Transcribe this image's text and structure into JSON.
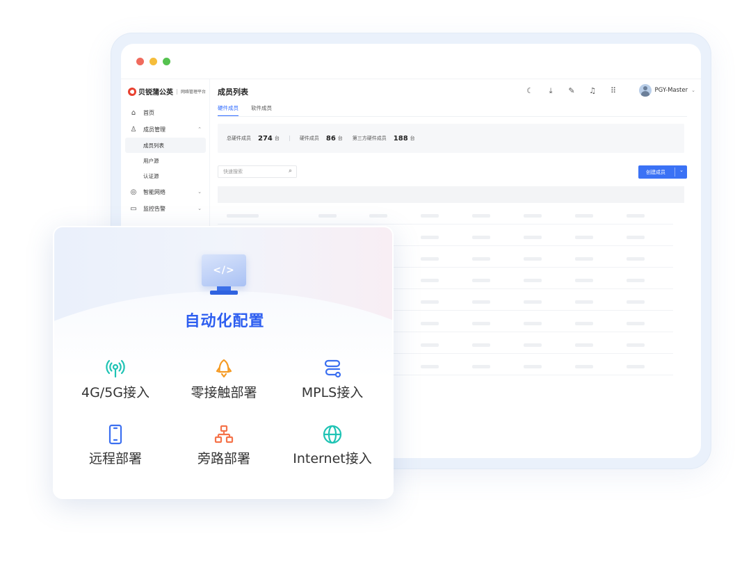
{
  "window": {
    "dots": [
      "#f06b5d",
      "#f5bd3b",
      "#55c24f"
    ]
  },
  "brand": {
    "name": "贝锐蒲公英",
    "subtitle": "网络管理平台"
  },
  "sidebar": {
    "items": [
      {
        "label": "首页",
        "icon": "home-icon",
        "glyph": "⌂"
      },
      {
        "label": "成员管理",
        "icon": "member-icon",
        "glyph": "♙",
        "chevron": "⌃"
      },
      {
        "label": "智能网络",
        "icon": "network-icon",
        "glyph": "◎",
        "chevron": "⌄"
      },
      {
        "label": "监控告警",
        "icon": "monitor-icon",
        "glyph": "▭",
        "chevron": "⌄"
      }
    ],
    "sub_items": [
      "成员列表",
      "用户源",
      "认证源"
    ]
  },
  "header": {
    "title": "成员列表",
    "icons": [
      {
        "name": "theme-icon",
        "glyph": "☾"
      },
      {
        "name": "download-icon",
        "glyph": "⤓"
      },
      {
        "name": "edit-icon",
        "glyph": "✎"
      },
      {
        "name": "bell-icon",
        "glyph": "♫"
      },
      {
        "name": "apps-icon",
        "glyph": "⠿"
      }
    ],
    "user": "PGY-Master",
    "user_chevron": "⌄"
  },
  "tabs": [
    "硬件成员",
    "软件成员"
  ],
  "stats": {
    "total_label": "总硬件成员",
    "total_value": "274",
    "hardware_label": "硬件成员",
    "hardware_value": "86",
    "third_label": "第三方硬件成员",
    "third_value": "188",
    "unit": "台"
  },
  "search": {
    "placeholder": "快速搜索",
    "icon_glyph": "⌕"
  },
  "create_button": {
    "label": "创建成员",
    "caret": "⌄"
  },
  "card": {
    "hero_glyph": "</>",
    "title": "自动化配置",
    "features": [
      {
        "label": "4G/5G接入",
        "icon": "signal-tower-icon",
        "color": "#1ec3b4"
      },
      {
        "label": "零接触部署",
        "icon": "rocket-icon",
        "color": "#f59a23"
      },
      {
        "label": "MPLS接入",
        "icon": "route-icon",
        "color": "#3b6ff0"
      },
      {
        "label": "远程部署",
        "icon": "phone-icon",
        "color": "#3b6ff0"
      },
      {
        "label": "旁路部署",
        "icon": "topology-icon",
        "color": "#f5734a"
      },
      {
        "label": "Internet接入",
        "icon": "globe-icon",
        "color": "#1ec3b4"
      }
    ]
  },
  "colors": {
    "accent": "#2f6bff",
    "title_blue": "#2d5ef0",
    "button": "#3b72f5"
  }
}
